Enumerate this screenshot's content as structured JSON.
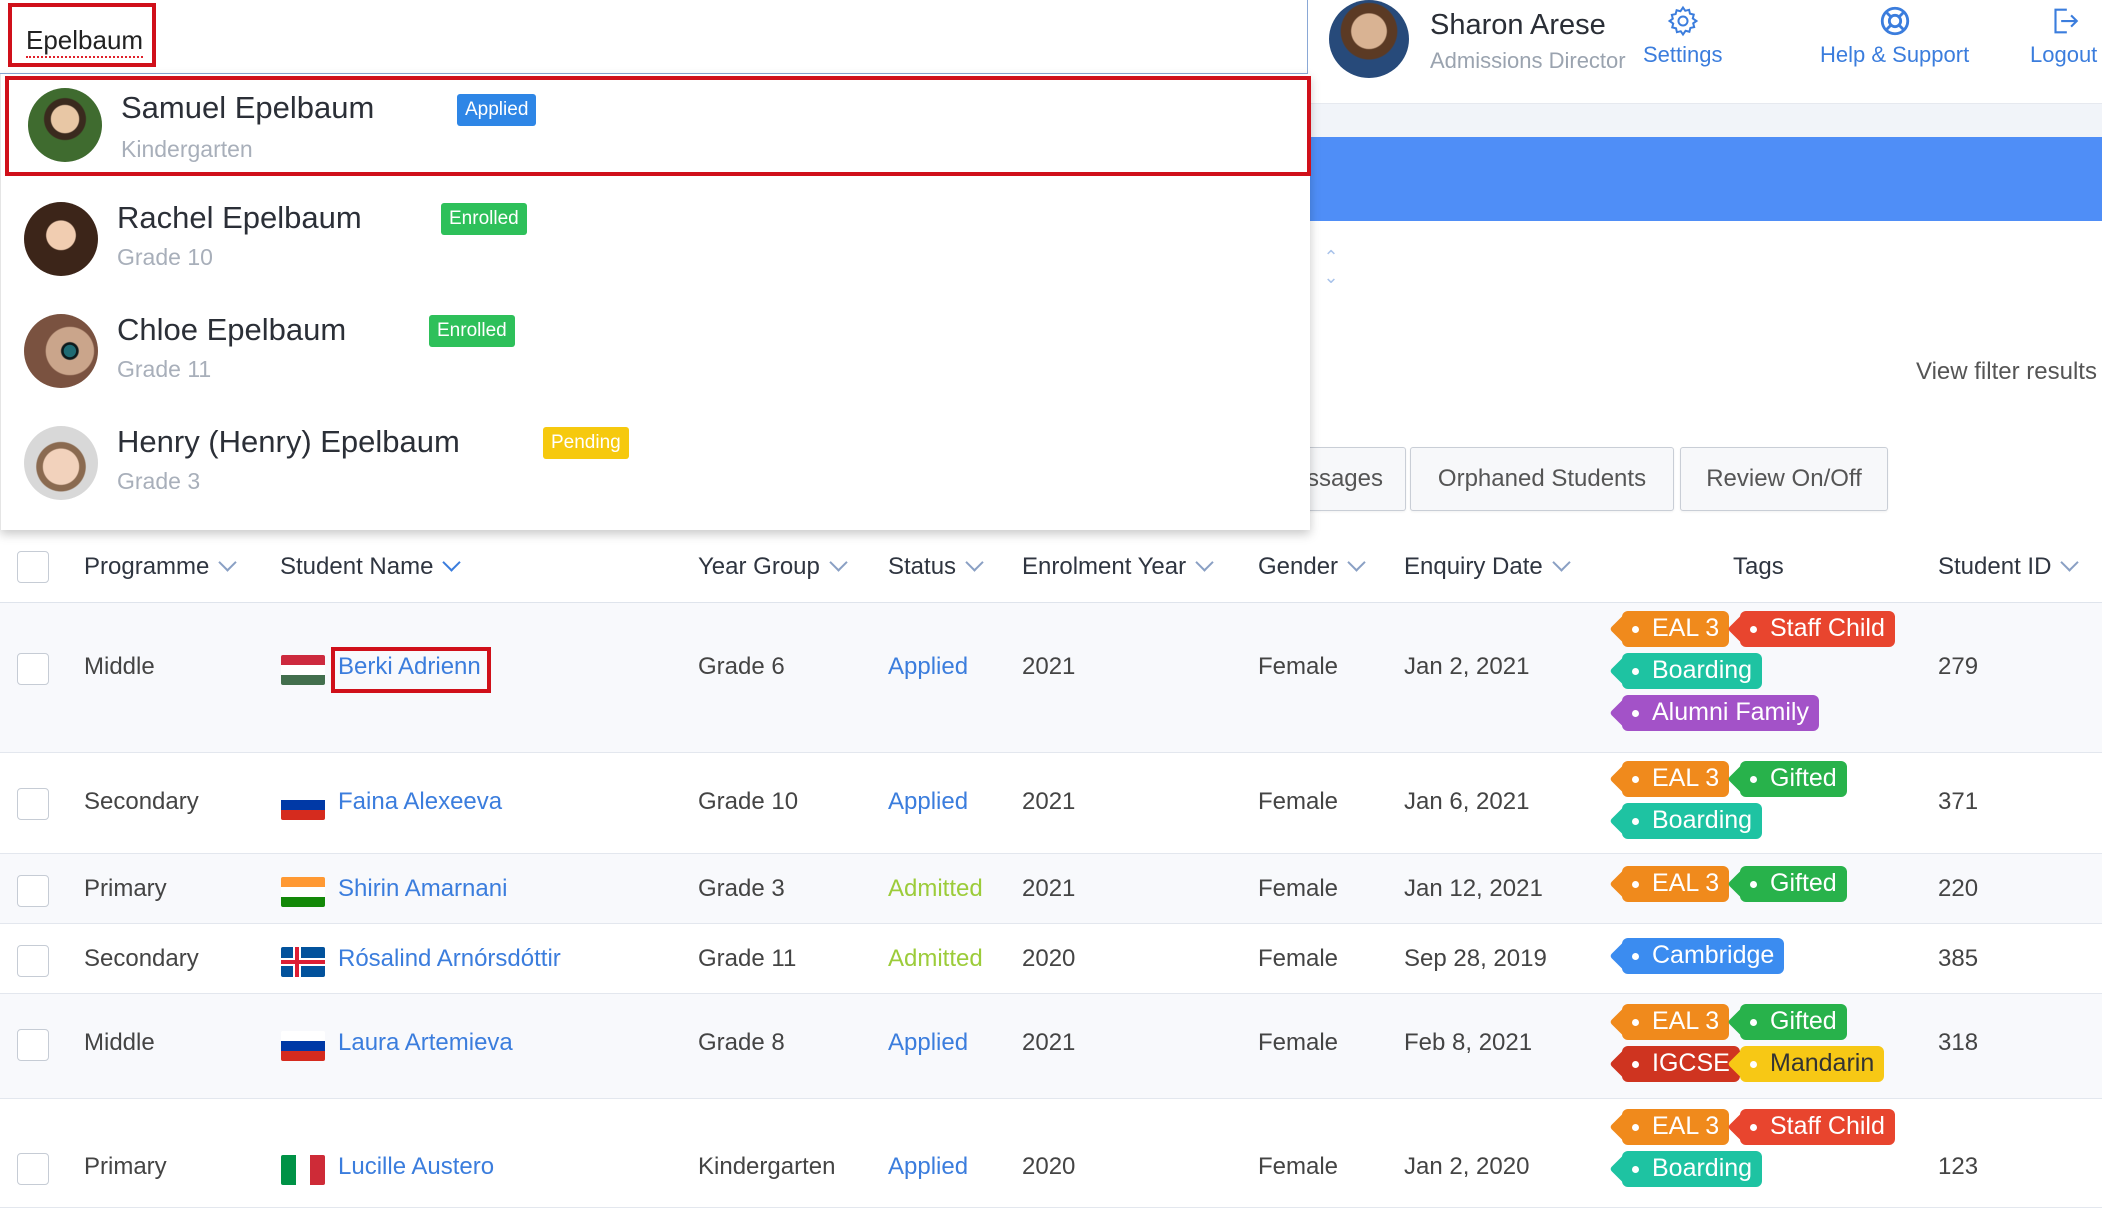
{
  "search": {
    "value": "Epelbaum"
  },
  "user": {
    "name": "Sharon Arese",
    "role": "Admissions Director"
  },
  "nav": {
    "settings": "Settings",
    "help": "Help & Support",
    "logout": "Logout"
  },
  "filters": {
    "view_results": "View filter results"
  },
  "tabs": {
    "messages_partial": "ssages",
    "orphaned": "Orphaned Students",
    "review": "Review On/Off"
  },
  "dropdown": [
    {
      "name": "Samuel Epelbaum",
      "grade": "Kindergarten",
      "status": "Applied"
    },
    {
      "name": "Rachel Epelbaum",
      "grade": "Grade 10",
      "status": "Enrolled"
    },
    {
      "name": "Chloe Epelbaum",
      "grade": "Grade 11",
      "status": "Enrolled"
    },
    {
      "name": "Henry (Henry) Epelbaum",
      "grade": "Grade 3",
      "status": "Pending"
    }
  ],
  "columns": {
    "programme": "Programme",
    "student_name": "Student Name",
    "year_group": "Year Group",
    "status": "Status",
    "enrolment_year": "Enrolment Year",
    "gender": "Gender",
    "enquiry_date": "Enquiry Date",
    "tags": "Tags",
    "student_id": "Student ID"
  },
  "rows": [
    {
      "programme": "Middle",
      "name": "Berki Adrienn",
      "flag": "hungary",
      "year": "Grade 6",
      "status": "Applied",
      "enrol": "2021",
      "gender": "Female",
      "enquiry": "Jan 2, 2021",
      "tags": [
        "EAL 3",
        "Staff Child",
        "Boarding",
        "Alumni Family"
      ],
      "id": "279"
    },
    {
      "programme": "Secondary",
      "name": "Faina Alexeeva",
      "flag": "russia",
      "year": "Grade 10",
      "status": "Applied",
      "enrol": "2021",
      "gender": "Female",
      "enquiry": "Jan 6, 2021",
      "tags": [
        "EAL 3",
        "Gifted",
        "Boarding"
      ],
      "id": "371"
    },
    {
      "programme": "Primary",
      "name": "Shirin Amarnani",
      "flag": "india",
      "year": "Grade 3",
      "status": "Admitted",
      "enrol": "2021",
      "gender": "Female",
      "enquiry": "Jan 12, 2021",
      "tags": [
        "EAL 3",
        "Gifted"
      ],
      "id": "220"
    },
    {
      "programme": "Secondary",
      "name": "Rósalind Arnórsdóttir",
      "flag": "iceland",
      "year": "Grade 11",
      "status": "Admitted",
      "enrol": "2020",
      "gender": "Female",
      "enquiry": "Sep 28, 2019",
      "tags": [
        "Cambridge"
      ],
      "id": "385"
    },
    {
      "programme": "Middle",
      "name": "Laura Artemieva",
      "flag": "russia",
      "year": "Grade 8",
      "status": "Applied",
      "enrol": "2021",
      "gender": "Female",
      "enquiry": "Feb 8, 2021",
      "tags": [
        "EAL 3",
        "Gifted",
        "IGCSE",
        "Mandarin"
      ],
      "id": "318"
    },
    {
      "programme": "Primary",
      "name": "Lucille Austero",
      "flag": "italy",
      "year": "Kindergarten",
      "status": "Applied",
      "enrol": "2020",
      "gender": "Female",
      "enquiry": "Jan 2, 2020",
      "tags": [
        "EAL 3",
        "Staff Child",
        "Boarding"
      ],
      "id": "123"
    }
  ],
  "colors": {
    "accent": "#3b7ddd",
    "band": "#4f8ef7",
    "highlight": "#d0101a",
    "admitted": "#9ccc3a"
  }
}
